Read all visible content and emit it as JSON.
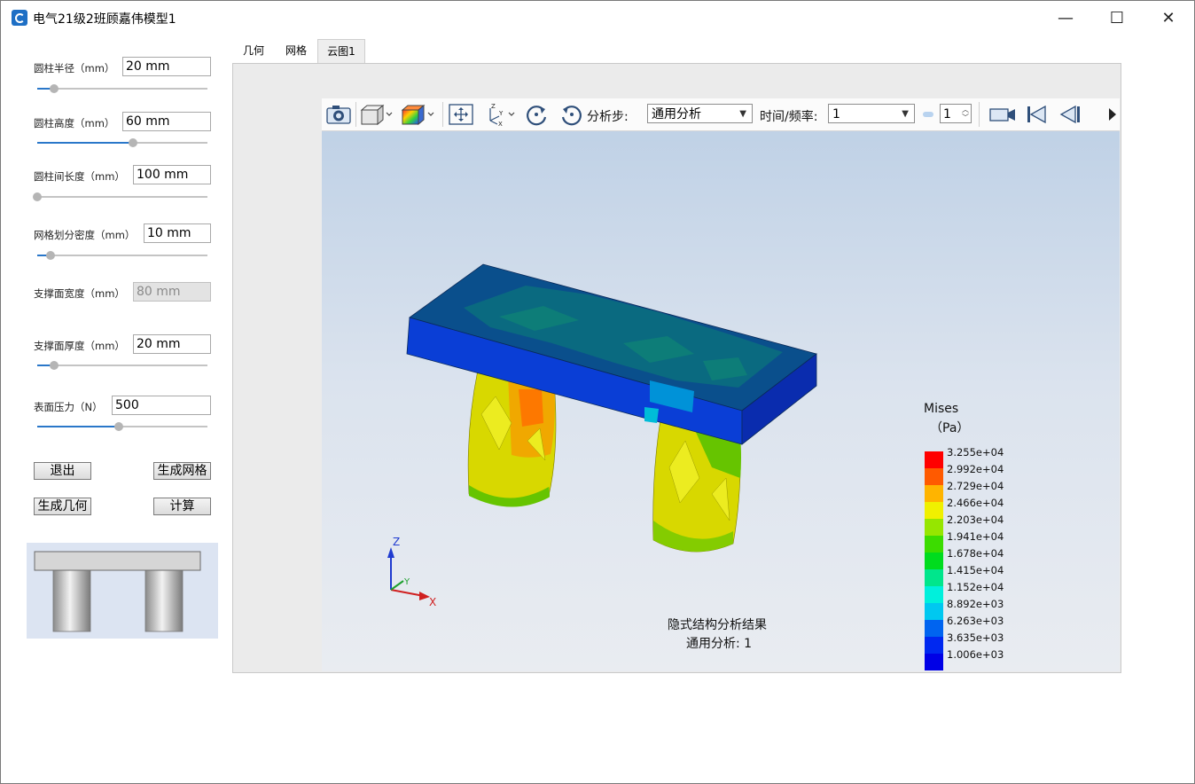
{
  "window": {
    "title": "电气21级2班顾嘉伟模型1",
    "minimize": "—",
    "maximize": "☐",
    "close": "✕"
  },
  "params": [
    {
      "label": "圆柱半径（mm）",
      "value": "20 mm",
      "slider": 0.1
    },
    {
      "label": "圆柱高度（mm）",
      "value": "60 mm",
      "slider": 0.56
    },
    {
      "label": "圆柱间长度（mm）",
      "value": "100 mm",
      "slider": 0.0
    },
    {
      "label": "网格划分密度（mm）",
      "value": "10 mm",
      "slider": 0.08
    },
    {
      "label": "支撑面宽度（mm）",
      "value": "80 mm"
    },
    {
      "label": "支撑面厚度（mm）",
      "value": "20 mm",
      "slider": 0.1
    },
    {
      "label": "表面压力（N）",
      "value": "500",
      "slider": 0.48
    }
  ],
  "buttons": {
    "exit": "退出",
    "gen_mesh": "生成网格",
    "gen_geom": "生成几何",
    "compute": "计算"
  },
  "tabs": [
    "几何",
    "网格",
    "云图1"
  ],
  "toolbar": {
    "step_label": "分析步:",
    "step_value": "通用分析",
    "time_label": "时间/频率:",
    "time_value": "1",
    "frame_value": "1"
  },
  "legend": {
    "title": "Mises",
    "unit": "（Pa）",
    "levels": [
      {
        "label": "3.255e+04",
        "color": "#ff0000"
      },
      {
        "label": "2.992e+04",
        "color": "#ff5a00"
      },
      {
        "label": "2.729e+04",
        "color": "#ffb400"
      },
      {
        "label": "2.466e+04",
        "color": "#f0f000"
      },
      {
        "label": "2.203e+04",
        "color": "#96e600"
      },
      {
        "label": "1.941e+04",
        "color": "#3cdc00"
      },
      {
        "label": "1.678e+04",
        "color": "#00dc1e"
      },
      {
        "label": "1.415e+04",
        "color": "#00e68c"
      },
      {
        "label": "1.152e+04",
        "color": "#00f0dc"
      },
      {
        "label": "8.892e+03",
        "color": "#00c8f0"
      },
      {
        "label": "6.263e+03",
        "color": "#0064f0"
      },
      {
        "label": "3.635e+03",
        "color": "#0028f0"
      },
      {
        "label": "1.006e+03",
        "color": "#0000e6"
      }
    ]
  },
  "result": {
    "caption": "隐式结构分析结果",
    "step": "通用分析: 1"
  },
  "axes": {
    "x": "X",
    "y": "Y",
    "z": "Z"
  }
}
